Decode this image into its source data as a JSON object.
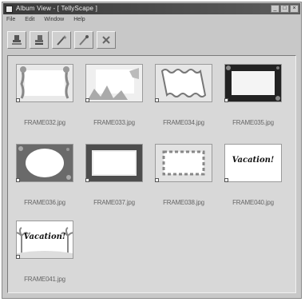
{
  "window": {
    "title": "Album View - [ TellyScape ]",
    "controls": [
      "_",
      "□",
      "×"
    ]
  },
  "menu": [
    "File",
    "Edit",
    "Window",
    "Help"
  ],
  "toolbar": {
    "buttons": [
      "stamp-icon",
      "stamp-alt-icon",
      "wand-icon",
      "wand-alt-icon",
      "delete-icon"
    ]
  },
  "files": [
    "FRAME032.jpg",
    "FRAME033.jpg",
    "FRAME034.jpg",
    "FRAME035.jpg",
    "FRAME036.jpg",
    "FRAME037.jpg",
    "FRAME038.jpg",
    "FRAME040.jpg",
    "FRAME041.jpg"
  ],
  "vacation_text": "Vacation!"
}
